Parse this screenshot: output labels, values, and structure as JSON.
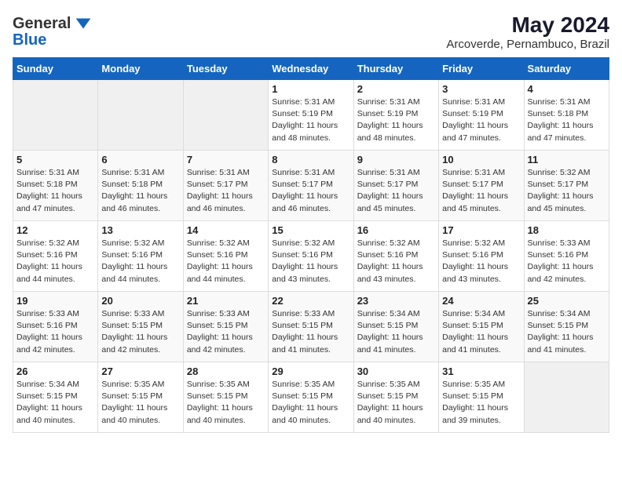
{
  "header": {
    "logo_line1": "General",
    "logo_line2": "Blue",
    "title": "May 2024",
    "subtitle": "Arcoverde, Pernambuco, Brazil"
  },
  "weekdays": [
    "Sunday",
    "Monday",
    "Tuesday",
    "Wednesday",
    "Thursday",
    "Friday",
    "Saturday"
  ],
  "weeks": [
    [
      {
        "day": "",
        "sunrise": "",
        "sunset": "",
        "daylight": "",
        "empty": true
      },
      {
        "day": "",
        "sunrise": "",
        "sunset": "",
        "daylight": "",
        "empty": true
      },
      {
        "day": "",
        "sunrise": "",
        "sunset": "",
        "daylight": "",
        "empty": true
      },
      {
        "day": "1",
        "sunrise": "Sunrise: 5:31 AM",
        "sunset": "Sunset: 5:19 PM",
        "daylight": "Daylight: 11 hours and 48 minutes."
      },
      {
        "day": "2",
        "sunrise": "Sunrise: 5:31 AM",
        "sunset": "Sunset: 5:19 PM",
        "daylight": "Daylight: 11 hours and 48 minutes."
      },
      {
        "day": "3",
        "sunrise": "Sunrise: 5:31 AM",
        "sunset": "Sunset: 5:19 PM",
        "daylight": "Daylight: 11 hours and 47 minutes."
      },
      {
        "day": "4",
        "sunrise": "Sunrise: 5:31 AM",
        "sunset": "Sunset: 5:18 PM",
        "daylight": "Daylight: 11 hours and 47 minutes."
      }
    ],
    [
      {
        "day": "5",
        "sunrise": "Sunrise: 5:31 AM",
        "sunset": "Sunset: 5:18 PM",
        "daylight": "Daylight: 11 hours and 47 minutes."
      },
      {
        "day": "6",
        "sunrise": "Sunrise: 5:31 AM",
        "sunset": "Sunset: 5:18 PM",
        "daylight": "Daylight: 11 hours and 46 minutes."
      },
      {
        "day": "7",
        "sunrise": "Sunrise: 5:31 AM",
        "sunset": "Sunset: 5:17 PM",
        "daylight": "Daylight: 11 hours and 46 minutes."
      },
      {
        "day": "8",
        "sunrise": "Sunrise: 5:31 AM",
        "sunset": "Sunset: 5:17 PM",
        "daylight": "Daylight: 11 hours and 46 minutes."
      },
      {
        "day": "9",
        "sunrise": "Sunrise: 5:31 AM",
        "sunset": "Sunset: 5:17 PM",
        "daylight": "Daylight: 11 hours and 45 minutes."
      },
      {
        "day": "10",
        "sunrise": "Sunrise: 5:31 AM",
        "sunset": "Sunset: 5:17 PM",
        "daylight": "Daylight: 11 hours and 45 minutes."
      },
      {
        "day": "11",
        "sunrise": "Sunrise: 5:32 AM",
        "sunset": "Sunset: 5:17 PM",
        "daylight": "Daylight: 11 hours and 45 minutes."
      }
    ],
    [
      {
        "day": "12",
        "sunrise": "Sunrise: 5:32 AM",
        "sunset": "Sunset: 5:16 PM",
        "daylight": "Daylight: 11 hours and 44 minutes."
      },
      {
        "day": "13",
        "sunrise": "Sunrise: 5:32 AM",
        "sunset": "Sunset: 5:16 PM",
        "daylight": "Daylight: 11 hours and 44 minutes."
      },
      {
        "day": "14",
        "sunrise": "Sunrise: 5:32 AM",
        "sunset": "Sunset: 5:16 PM",
        "daylight": "Daylight: 11 hours and 44 minutes."
      },
      {
        "day": "15",
        "sunrise": "Sunrise: 5:32 AM",
        "sunset": "Sunset: 5:16 PM",
        "daylight": "Daylight: 11 hours and 43 minutes."
      },
      {
        "day": "16",
        "sunrise": "Sunrise: 5:32 AM",
        "sunset": "Sunset: 5:16 PM",
        "daylight": "Daylight: 11 hours and 43 minutes."
      },
      {
        "day": "17",
        "sunrise": "Sunrise: 5:32 AM",
        "sunset": "Sunset: 5:16 PM",
        "daylight": "Daylight: 11 hours and 43 minutes."
      },
      {
        "day": "18",
        "sunrise": "Sunrise: 5:33 AM",
        "sunset": "Sunset: 5:16 PM",
        "daylight": "Daylight: 11 hours and 42 minutes."
      }
    ],
    [
      {
        "day": "19",
        "sunrise": "Sunrise: 5:33 AM",
        "sunset": "Sunset: 5:16 PM",
        "daylight": "Daylight: 11 hours and 42 minutes."
      },
      {
        "day": "20",
        "sunrise": "Sunrise: 5:33 AM",
        "sunset": "Sunset: 5:15 PM",
        "daylight": "Daylight: 11 hours and 42 minutes."
      },
      {
        "day": "21",
        "sunrise": "Sunrise: 5:33 AM",
        "sunset": "Sunset: 5:15 PM",
        "daylight": "Daylight: 11 hours and 42 minutes."
      },
      {
        "day": "22",
        "sunrise": "Sunrise: 5:33 AM",
        "sunset": "Sunset: 5:15 PM",
        "daylight": "Daylight: 11 hours and 41 minutes."
      },
      {
        "day": "23",
        "sunrise": "Sunrise: 5:34 AM",
        "sunset": "Sunset: 5:15 PM",
        "daylight": "Daylight: 11 hours and 41 minutes."
      },
      {
        "day": "24",
        "sunrise": "Sunrise: 5:34 AM",
        "sunset": "Sunset: 5:15 PM",
        "daylight": "Daylight: 11 hours and 41 minutes."
      },
      {
        "day": "25",
        "sunrise": "Sunrise: 5:34 AM",
        "sunset": "Sunset: 5:15 PM",
        "daylight": "Daylight: 11 hours and 41 minutes."
      }
    ],
    [
      {
        "day": "26",
        "sunrise": "Sunrise: 5:34 AM",
        "sunset": "Sunset: 5:15 PM",
        "daylight": "Daylight: 11 hours and 40 minutes."
      },
      {
        "day": "27",
        "sunrise": "Sunrise: 5:35 AM",
        "sunset": "Sunset: 5:15 PM",
        "daylight": "Daylight: 11 hours and 40 minutes."
      },
      {
        "day": "28",
        "sunrise": "Sunrise: 5:35 AM",
        "sunset": "Sunset: 5:15 PM",
        "daylight": "Daylight: 11 hours and 40 minutes."
      },
      {
        "day": "29",
        "sunrise": "Sunrise: 5:35 AM",
        "sunset": "Sunset: 5:15 PM",
        "daylight": "Daylight: 11 hours and 40 minutes."
      },
      {
        "day": "30",
        "sunrise": "Sunrise: 5:35 AM",
        "sunset": "Sunset: 5:15 PM",
        "daylight": "Daylight: 11 hours and 40 minutes."
      },
      {
        "day": "31",
        "sunrise": "Sunrise: 5:35 AM",
        "sunset": "Sunset: 5:15 PM",
        "daylight": "Daylight: 11 hours and 39 minutes."
      },
      {
        "day": "",
        "sunrise": "",
        "sunset": "",
        "daylight": "",
        "empty": true
      }
    ]
  ]
}
